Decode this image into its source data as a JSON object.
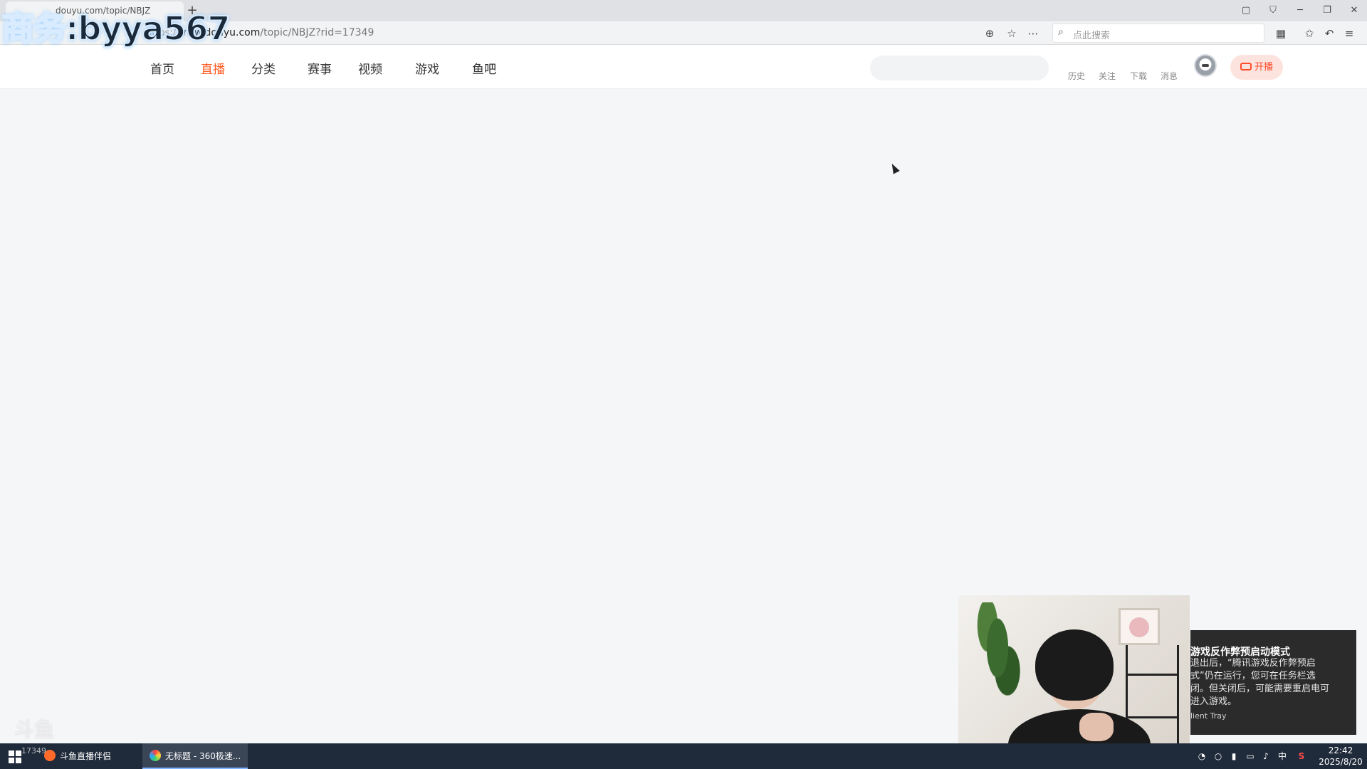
{
  "browser": {
    "tab_title": "douyu.com/topic/NBJZ",
    "url_scheme": "https://",
    "url_host": "www.douyu.com",
    "url_path": "/topic/NBJZ?rid=17349",
    "search_placeholder": "点此搜索",
    "new_tab": "+",
    "window_controls": {
      "minimize": "─",
      "restore": "❐",
      "close": "✕"
    }
  },
  "watermark": {
    "text": "商务:byya567"
  },
  "header": {
    "nav": [
      "首页",
      "直播",
      "分类",
      "赛事",
      "视频",
      "游戏",
      "鱼吧"
    ],
    "active_nav": "直播",
    "quick_links": [
      "历史",
      "关注",
      "下载",
      "消息"
    ],
    "live_button": "开播",
    "accent": "#ff5d23"
  },
  "notification": {
    "title": "游戏反作弊预启动模式",
    "body": "退出后，“腾讯游戏反作弊预启式”仍在运行，您可在任务栏选闭。但关闭后，可能需要重启电可进入游戏。",
    "source": "lient Tray"
  },
  "taskbar": {
    "apps": [
      {
        "label": "斗鱼直播伴侣",
        "color": "#ff6a2a"
      },
      {
        "label": "无标题 - 360极速...",
        "color": "#2aa7ff"
      }
    ],
    "tray": {
      "ime": "中"
    },
    "clock_time": "22:42",
    "clock_date": "2025/8/20",
    "desktop_id": "17349"
  }
}
